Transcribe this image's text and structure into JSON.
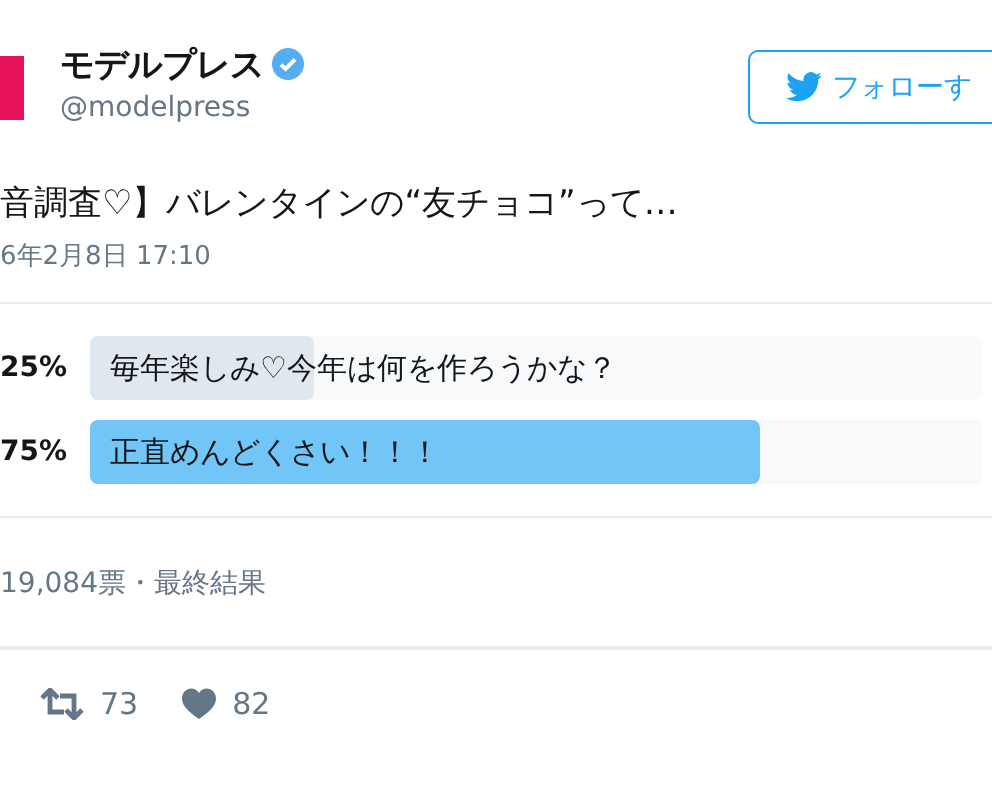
{
  "account": {
    "name": "モデルプレス",
    "verified": true,
    "handle": "@modelpress"
  },
  "follow_button": {
    "label": "フォローす"
  },
  "tweet": {
    "text": "音調査♡】バレンタインの“友チョコ”って…",
    "date": "6年2月8日 17:10"
  },
  "poll": {
    "options": [
      {
        "percent": "25%",
        "label": "毎年楽しみ♡今年は何を作ろうかな？",
        "level": 0.25
      },
      {
        "percent": "75%",
        "label": "正直めんどくさい！！！",
        "level": 0.75
      }
    ],
    "summary": "19,084票・最終結果"
  },
  "actions": [
    {
      "kind": "retweet",
      "count": "73"
    },
    {
      "kind": "like",
      "count": "82"
    }
  ]
}
